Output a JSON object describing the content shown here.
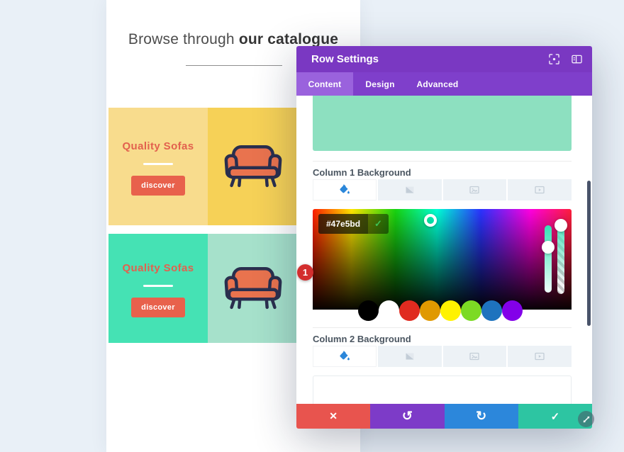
{
  "page": {
    "heading_regular": "Browse through ",
    "heading_bold": "our catalogue"
  },
  "cards": [
    {
      "title": "Quality Sofas",
      "button_label": "discover",
      "left_bg": "#f8dc8d",
      "right_bg": "#f6d157"
    },
    {
      "title": "Quality Sofas",
      "button_label": "discover",
      "left_bg": "#45e2b4",
      "right_bg": "#a6e1cb"
    }
  ],
  "modal": {
    "title": "Row Settings",
    "tabs": [
      "Content",
      "Design",
      "Advanced"
    ],
    "active_tab": "Content",
    "column1_label": "Column 1 Background",
    "column2_label": "Column 2 Background",
    "background_type_tabs": [
      "color",
      "gradient",
      "image",
      "video"
    ],
    "column1_preview_color": "#8de0c0",
    "color_picker": {
      "hex_value": "#47e5bd",
      "confirm_icon": "✓",
      "annotation_badge": "1",
      "selected_color": "#47e5bd",
      "preset_colors": [
        "#000000",
        "#ffffff",
        "#e02b20",
        "#e09900",
        "#fff200",
        "#7cda24",
        "#1e73be",
        "#8300e9"
      ]
    },
    "footer_icons": {
      "discard": "✕",
      "undo": "↺",
      "redo": "↻",
      "save": "✓"
    },
    "accent_colors": {
      "header_purple": "#7a38c2",
      "tabbar_purple": "#7f3fcb",
      "active_tab_purple": "#9a62dd",
      "discard_red": "#e8544e",
      "undo_purple": "#7d3bc8",
      "redo_blue": "#2c87db",
      "save_green": "#2dc5a2",
      "icon_blue": "#2b87da"
    }
  }
}
